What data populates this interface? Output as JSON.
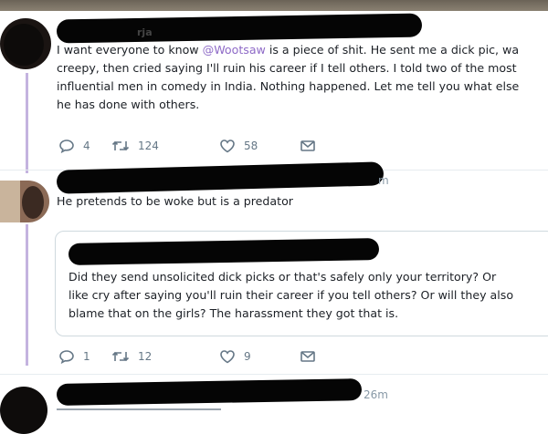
{
  "tweets": [
    {
      "text_before": "I want everyone to know ",
      "mention": "@Wootsaw",
      "text_line1_after": " is a piece of shit. He sent me a dick pic, wa",
      "line2": "creepy, then cried saying I'll ruin his career if I tell others. I told two of the most",
      "line3": "influential men in comedy in India. Nothing happened. Let me tell you what else",
      "line4": "he has done with others.",
      "header_fragment": "rja",
      "replies": "4",
      "retweets": "124",
      "likes": "58"
    },
    {
      "text": "He pretends to be woke but is a predator",
      "header_fragment": "m",
      "quote": {
        "line1": "Did they send unsolicited dick picks or that's safely only your territory? Or",
        "line2": "like cry after saying you'll ruin their career if you tell others? Or will they also",
        "line3": "blame that on the girls? The harassment they got that is."
      },
      "replies": "1",
      "retweets": "12",
      "likes": "9"
    },
    {
      "timestamp": "26m"
    }
  ],
  "colors": {
    "accent": "#8e6ac7",
    "thread_line": "#c4b3df",
    "icon_gray": "#657786"
  },
  "icons": {
    "reply": "reply-icon",
    "retweet": "retweet-icon",
    "like": "like-icon",
    "message": "message-icon"
  }
}
